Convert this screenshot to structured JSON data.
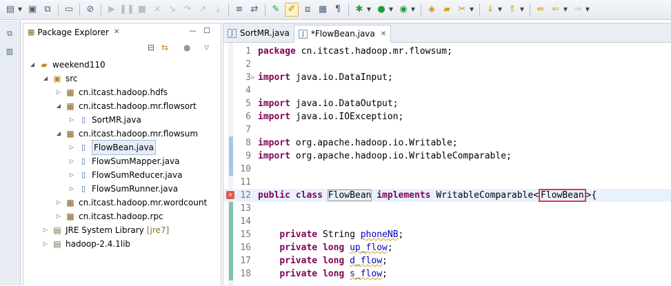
{
  "toolbar": {
    "icons": [
      "new-icon",
      "save-icon",
      "save-all-icon",
      "print-icon",
      "skip-breakpoints-icon",
      "resume-icon",
      "suspend-icon",
      "terminate-icon",
      "disconnect-icon",
      "step-into-icon",
      "step-over-icon",
      "step-return-icon",
      "drop-to-frame-icon",
      "use-step-filters-icon",
      "open-type-icon",
      "toggle-mark-occurrences-icon",
      "toggle-block-selection-icon",
      "show-whitespace-icon",
      "debug-icon",
      "run-icon",
      "external-tools-icon",
      "new-java-project-icon",
      "open-folder-icon",
      "search-icon",
      "next-annotation-icon",
      "previous-annotation-icon",
      "back-icon",
      "forward-icon"
    ]
  },
  "left_trim": {
    "icons": [
      "restore-icon",
      "package-explorer-minimized-icon"
    ]
  },
  "package_explorer": {
    "title": "Package Explorer",
    "close_glyph": "✕",
    "toolbar_icons": [
      "collapse-all-icon",
      "link-with-editor-icon",
      "focus-active-task-icon",
      "view-menu-icon"
    ],
    "tree": [
      {
        "label": "weekend110",
        "type": "project",
        "expanded": true,
        "depth": 0
      },
      {
        "label": "src",
        "type": "source-folder",
        "expanded": true,
        "depth": 1
      },
      {
        "label": "cn.itcast.hadoop.hdfs",
        "type": "package",
        "expanded": false,
        "depth": 2
      },
      {
        "label": "cn.itcast.hadoop.mr.flowsort",
        "type": "package",
        "expanded": true,
        "depth": 2
      },
      {
        "label": "SortMR.java",
        "type": "java-file",
        "expanded": false,
        "depth": 3
      },
      {
        "label": "cn.itcast.hadoop.mr.flowsum",
        "type": "package",
        "expanded": true,
        "depth": 2
      },
      {
        "label": "FlowBean.java",
        "type": "java-file",
        "expanded": false,
        "depth": 3,
        "selected": true
      },
      {
        "label": "FlowSumMapper.java",
        "type": "java-file",
        "expanded": false,
        "depth": 3
      },
      {
        "label": "FlowSumReducer.java",
        "type": "java-file",
        "expanded": false,
        "depth": 3
      },
      {
        "label": "FlowSumRunner.java",
        "type": "java-file",
        "expanded": false,
        "depth": 3
      },
      {
        "label": "cn.itcast.hadoop.mr.wordcount",
        "type": "package",
        "expanded": false,
        "depth": 2
      },
      {
        "label": "cn.itcast.hadoop.rpc",
        "type": "package",
        "expanded": false,
        "depth": 2
      },
      {
        "label": "JRE System Library",
        "suffix": "[jre7]",
        "type": "library",
        "expanded": false,
        "depth": 1
      },
      {
        "label": "hadoop-2.4.1lib",
        "type": "library",
        "expanded": false,
        "depth": 1
      }
    ]
  },
  "editor": {
    "tabs": [
      {
        "label": "SortMR.java",
        "active": false
      },
      {
        "label": "*FlowBean.java",
        "active": true
      }
    ],
    "close_glyph": "✕",
    "current_line": 12,
    "lines": [
      {
        "n": "1",
        "tokens": [
          {
            "t": "package",
            "c": "kw"
          },
          {
            "t": " cn.itcast.hadoop.mr.flowsum;"
          }
        ]
      },
      {
        "n": "2",
        "tokens": []
      },
      {
        "n": "3",
        "fold": true,
        "tokens": [
          {
            "t": "import",
            "c": "kw"
          },
          {
            "t": " java.io.DataInput;"
          }
        ]
      },
      {
        "n": "4",
        "tokens": []
      },
      {
        "n": "5",
        "tokens": [
          {
            "t": "import",
            "c": "kw"
          },
          {
            "t": " java.io.DataOutput;"
          }
        ]
      },
      {
        "n": "6",
        "tokens": [
          {
            "t": "import",
            "c": "kw"
          },
          {
            "t": " java.io.IOException;"
          }
        ]
      },
      {
        "n": "7",
        "tokens": []
      },
      {
        "n": "8",
        "tokens": [
          {
            "t": "import",
            "c": "kw"
          },
          {
            "t": " org.apache.hadoop.io.Writable;"
          }
        ]
      },
      {
        "n": "9",
        "tokens": [
          {
            "t": "import",
            "c": "kw"
          },
          {
            "t": " org.apache.hadoop.io.WritableComparable;"
          }
        ]
      },
      {
        "n": "10",
        "tokens": []
      },
      {
        "n": "11",
        "tokens": []
      },
      {
        "n": "12",
        "error": true,
        "tokens": [
          {
            "t": "public",
            "c": "kw"
          },
          {
            "t": " "
          },
          {
            "t": "class",
            "c": "kw"
          },
          {
            "t": " "
          },
          {
            "t": "FlowBean",
            "c": "bracket-box"
          },
          {
            "t": " "
          },
          {
            "t": "implements",
            "c": "kw"
          },
          {
            "t": " WritableComparable<"
          },
          {
            "t": "FlowBean",
            "c": "redbox"
          },
          {
            "t": ">{"
          }
        ]
      },
      {
        "n": "13",
        "tokens": []
      },
      {
        "n": "14",
        "tokens": []
      },
      {
        "n": "15",
        "tokens": [
          {
            "t": "    "
          },
          {
            "t": "private",
            "c": "kw"
          },
          {
            "t": " String "
          },
          {
            "t": "phoneNB",
            "c": "fld warn"
          },
          {
            "t": ";"
          }
        ]
      },
      {
        "n": "16",
        "tokens": [
          {
            "t": "    "
          },
          {
            "t": "private",
            "c": "kw"
          },
          {
            "t": " "
          },
          {
            "t": "long",
            "c": "kw"
          },
          {
            "t": " "
          },
          {
            "t": "up_flow",
            "c": "fld warn"
          },
          {
            "t": ";"
          }
        ]
      },
      {
        "n": "17",
        "tokens": [
          {
            "t": "    "
          },
          {
            "t": "private",
            "c": "kw"
          },
          {
            "t": " "
          },
          {
            "t": "long",
            "c": "kw"
          },
          {
            "t": " "
          },
          {
            "t": "d_flow",
            "c": "fld warn"
          },
          {
            "t": ";"
          }
        ]
      },
      {
        "n": "18",
        "tokens": [
          {
            "t": "    "
          },
          {
            "t": "private",
            "c": "kw"
          },
          {
            "t": " "
          },
          {
            "t": "long",
            "c": "kw"
          },
          {
            "t": " "
          },
          {
            "t": "s_flow",
            "c": "fld warn"
          },
          {
            "t": ";"
          }
        ]
      }
    ]
  }
}
